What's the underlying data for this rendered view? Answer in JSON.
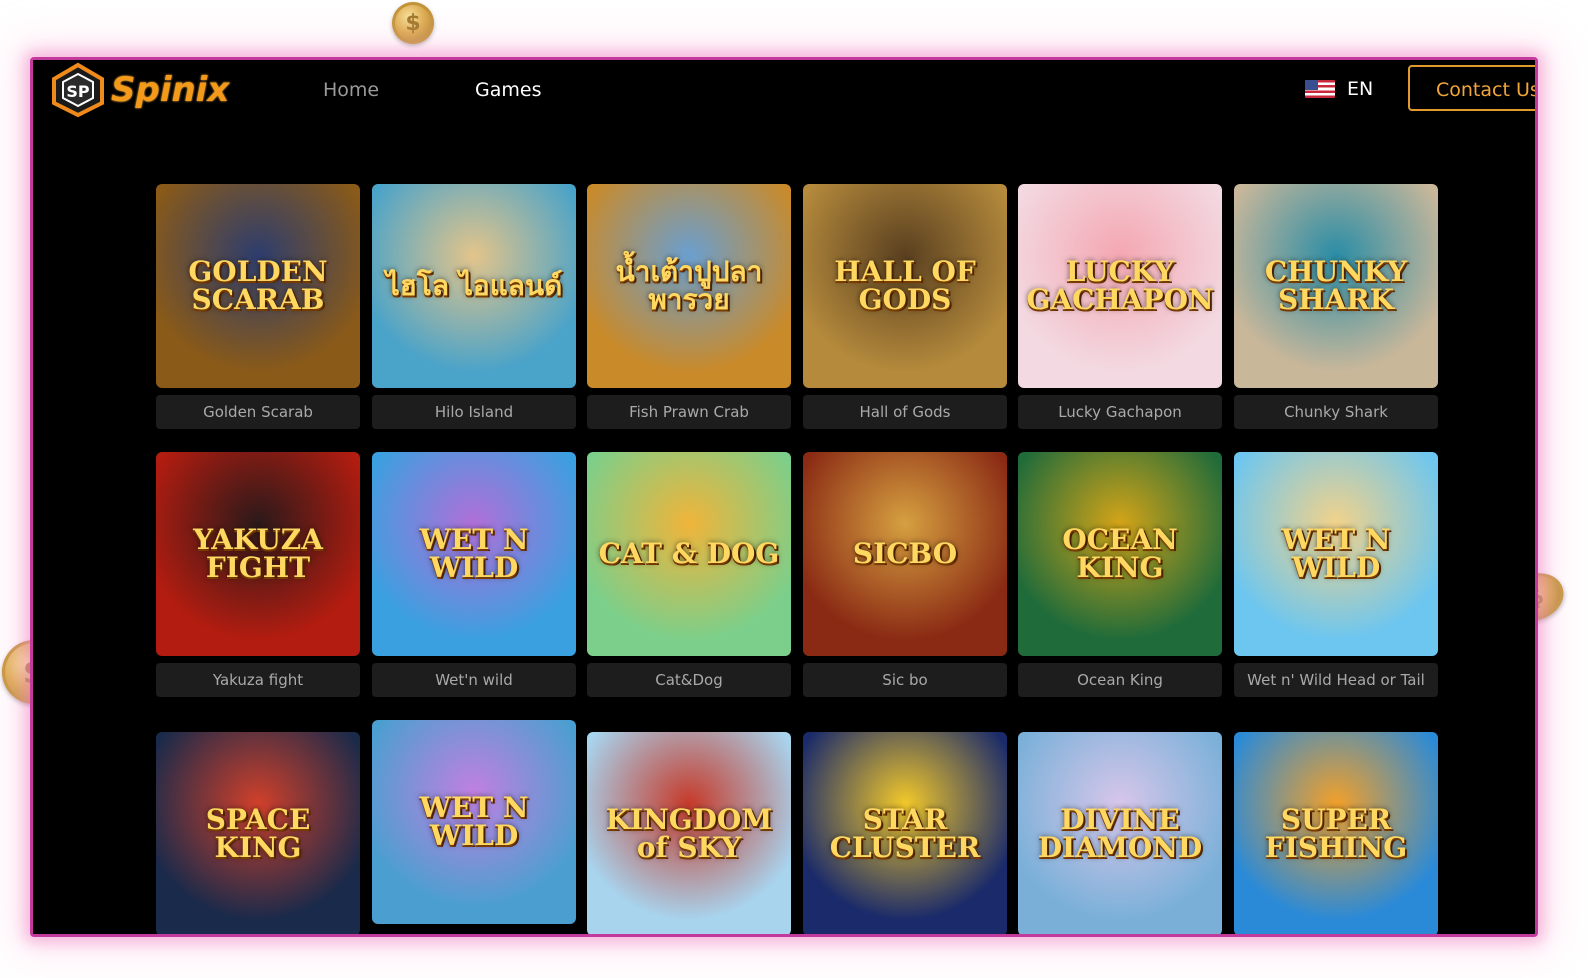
{
  "brand": {
    "name": "Spinix"
  },
  "nav": {
    "home": "Home",
    "games": "Games"
  },
  "lang": {
    "label": "EN"
  },
  "contact": {
    "label": "Contact Us"
  },
  "games": [
    {
      "title": "GOLDEN SCARAB",
      "label": "Golden Scarab",
      "bg": "#8a5a18",
      "bg2": "#2d3d6e"
    },
    {
      "title": "ไฮโล ไอแลนด์",
      "label": "Hilo Island",
      "bg": "#4aa3c9",
      "bg2": "#e3c48a"
    },
    {
      "title": "น้ำเต้าปูปลา พารวย",
      "label": "Fish Prawn Crab",
      "bg": "#c98a2a",
      "bg2": "#6a9fd0"
    },
    {
      "title": "HALL OF GODS",
      "label": "Hall of Gods",
      "bg": "#b58a3c",
      "bg2": "#5a4020"
    },
    {
      "title": "LUCKY GACHAPON",
      "label": "Lucky Gachapon",
      "bg": "#f3d9e1",
      "bg2": "#f4a7b2"
    },
    {
      "title": "CHUNKY SHARK",
      "label": "Chunky Shark",
      "bg": "#c9b79a",
      "bg2": "#2a8da6"
    },
    {
      "title": "YAKUZA FIGHT",
      "label": "Yakuza fight",
      "bg": "#b31c10",
      "bg2": "#2b1a1a"
    },
    {
      "title": "WET N WILD",
      "label": "Wet'n wild",
      "bg": "#3aa0e0",
      "bg2": "#b06fd8"
    },
    {
      "title": "CAT & DOG",
      "label": "Cat&Dog",
      "bg": "#7ccf8a",
      "bg2": "#f0b43a"
    },
    {
      "title": "SICBO",
      "label": "Sic bo",
      "bg": "#8a2a14",
      "bg2": "#d6a040"
    },
    {
      "title": "OCEAN KING",
      "label": "Ocean King",
      "bg": "#1f6b3a",
      "bg2": "#d4a418"
    },
    {
      "title": "WET N WILD",
      "label": "Wet n' Wild Head or Tail",
      "bg": "#6cc6f0",
      "bg2": "#f2d28a"
    },
    {
      "title": "SPACE KING",
      "label": "",
      "bg": "#1a2a4a",
      "bg2": "#d0402a"
    },
    {
      "title": "WET N WILD",
      "label": "",
      "bg": "#4a9fd0",
      "bg2": "#c080e0"
    },
    {
      "title": "KINGDOM of SKY",
      "label": "",
      "bg": "#a8d4ee",
      "bg2": "#c63a2a"
    },
    {
      "title": "STAR CLUSTER",
      "label": "",
      "bg": "#1a2a6a",
      "bg2": "#f2c82a"
    },
    {
      "title": "DIVINE DIAMOND",
      "label": "",
      "bg": "#7ab0d8",
      "bg2": "#d7c6ea"
    },
    {
      "title": "SUPER FISHING",
      "label": "",
      "bg": "#2a8ad8",
      "bg2": "#f2a02a"
    }
  ],
  "coins": [
    {
      "symbol": "$"
    },
    {
      "symbol": "$"
    },
    {
      "symbol": "$"
    }
  ]
}
